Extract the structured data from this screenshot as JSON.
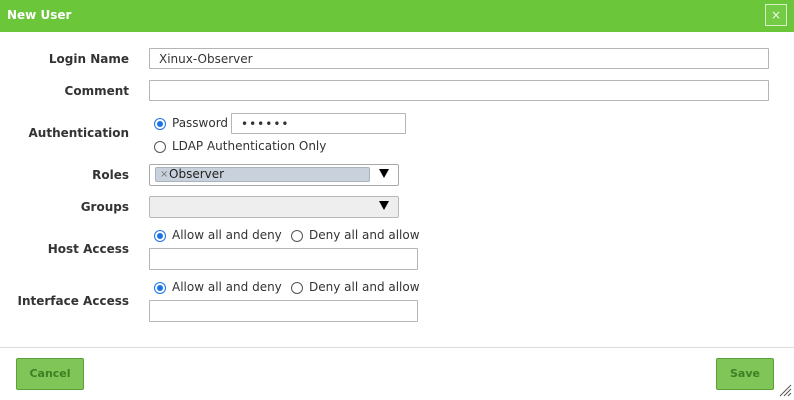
{
  "dialog": {
    "title": "New User",
    "close_glyph": "×"
  },
  "form": {
    "login_name": {
      "label": "Login Name",
      "value": "Xinux-Observer"
    },
    "comment": {
      "label": "Comment",
      "value": ""
    },
    "authentication": {
      "label": "Authentication",
      "options": [
        {
          "label": "Password",
          "checked": true
        },
        {
          "label": "LDAP Authentication Only",
          "checked": false
        }
      ],
      "password_value": "••••••"
    },
    "roles": {
      "label": "Roles",
      "selected": [
        {
          "label": "Observer",
          "remove_glyph": "×"
        }
      ]
    },
    "groups": {
      "label": "Groups",
      "selected": []
    },
    "host_access": {
      "label": "Host Access",
      "options": [
        {
          "label": "Allow all and deny",
          "checked": true
        },
        {
          "label": "Deny all and allow",
          "checked": false
        }
      ],
      "value": ""
    },
    "interface_access": {
      "label": "Interface Access",
      "options": [
        {
          "label": "Allow all and deny",
          "checked": true
        },
        {
          "label": "Deny all and allow",
          "checked": false
        }
      ],
      "value": ""
    }
  },
  "footer": {
    "cancel_label": "Cancel",
    "save_label": "Save"
  },
  "colors": {
    "header_bg": "#6cc63a",
    "button_bg": "#7fc557",
    "radio_accent": "#1a73e8"
  },
  "icons": {
    "close": "close-icon",
    "dropdown": "caret-down-icon",
    "resize": "resize-grip-icon"
  }
}
